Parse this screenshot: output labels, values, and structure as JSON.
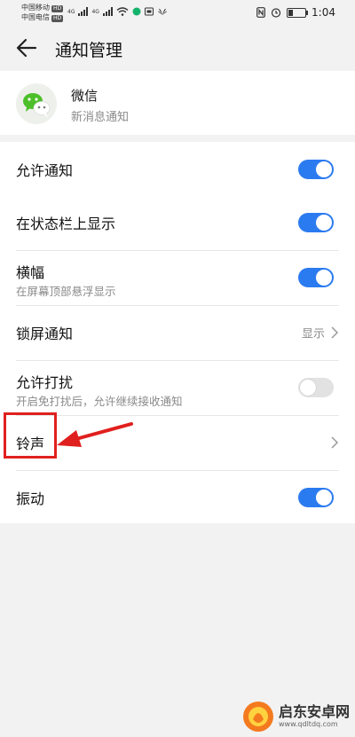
{
  "status_bar": {
    "carrier1": "中国移动",
    "carrier2": "中国电信",
    "hd": "HD",
    "net1": "4G",
    "net2": "4G",
    "time": "1:04"
  },
  "header": {
    "title": "通知管理"
  },
  "app": {
    "name": "微信",
    "subtitle": "新消息通知"
  },
  "settings": {
    "allow": {
      "label": "允许通知",
      "enabled": true
    },
    "status_bar": {
      "label": "在状态栏上显示",
      "enabled": true
    },
    "banner": {
      "label": "横幅",
      "sub": "在屏幕顶部悬浮显示",
      "enabled": true
    },
    "lockscreen": {
      "label": "锁屏通知",
      "value": "显示"
    },
    "dnd": {
      "label": "允许打扰",
      "sub": "开启免打扰后，允许继续接收通知",
      "enabled": false
    },
    "ringtone": {
      "label": "铃声"
    },
    "vibrate": {
      "label": "振动",
      "enabled": true
    }
  },
  "watermark": {
    "title": "启东安卓网",
    "url": "www.qdltdq.com"
  },
  "colors": {
    "accent": "#2b7bf0",
    "highlight": "#e0201e"
  }
}
